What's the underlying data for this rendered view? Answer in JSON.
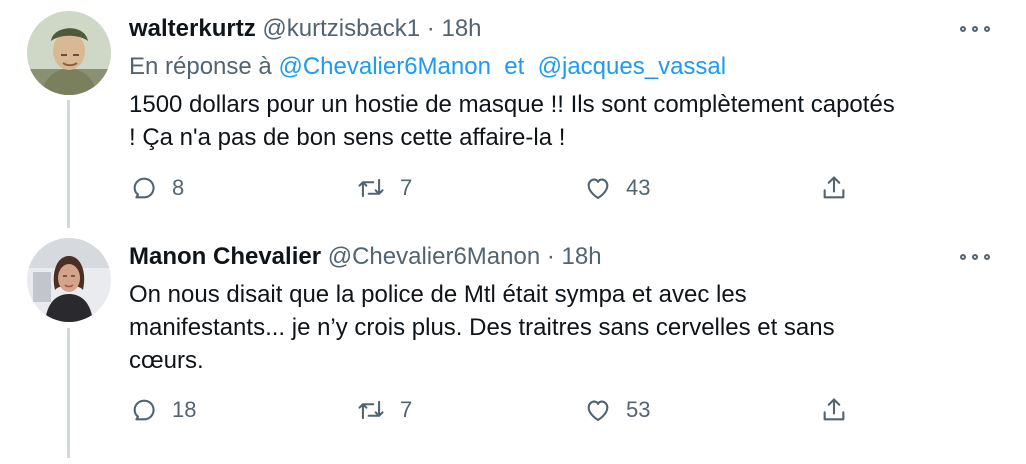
{
  "tweets": [
    {
      "name": "walterkurtz",
      "handle": "@kurtzisback1",
      "separator": "·",
      "time": "18h",
      "reply_prefix": "En réponse à",
      "reply_mentions": [
        "@Chevalier6Manon",
        "@jacques_vassal"
      ],
      "reply_joiner": "et",
      "text_lines": [
        "1500 dollars pour un hostie de masque !! Ils sont complètement capotés",
        "! Ça n'a pas de bon sens cette affaire-la !"
      ],
      "counts": {
        "replies": "8",
        "retweets": "7",
        "likes": "43"
      }
    },
    {
      "name": "Manon Chevalier",
      "handle": "@Chevalier6Manon",
      "separator": "·",
      "time": "18h",
      "text_lines": [
        "On nous disait que la police de Mtl était sympa et avec les",
        "manifestants... je n’y crois plus. Des traitres sans cervelles et sans",
        "cœurs."
      ],
      "counts": {
        "replies": "18",
        "retweets": "7",
        "likes": "53"
      }
    }
  ],
  "icons": {
    "reply": "reply-icon",
    "retweet": "retweet-icon",
    "like": "like-icon",
    "share": "share-icon",
    "more": "more-icon"
  },
  "colors": {
    "text": "#0f1419",
    "secondary": "#536471",
    "link": "#1d9bf0",
    "thread_line": "#cfd9de"
  }
}
